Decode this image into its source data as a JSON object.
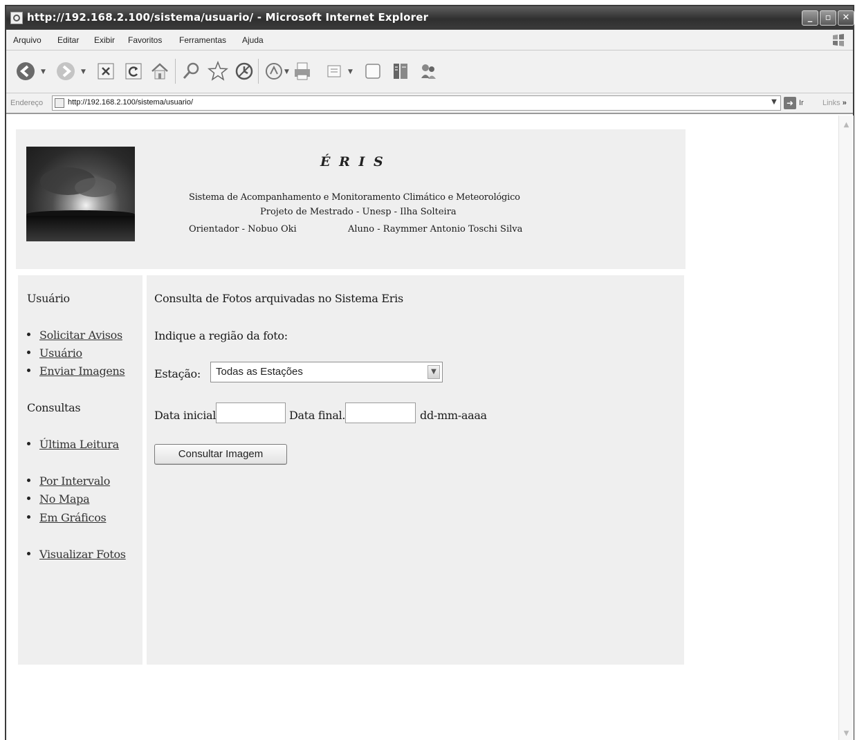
{
  "window": {
    "title": "http://192.168.2.100/sistema/usuario/ - Microsoft Internet Explorer",
    "min_glyph": "_",
    "max_glyph": "▫",
    "close_glyph": "✕"
  },
  "menu": [
    "Arquivo",
    "Editar",
    "Exibir",
    "Favoritos",
    "Ferramentas",
    "Ajuda"
  ],
  "toolbar": {
    "icons": [
      "back-icon",
      "forward-icon",
      "stop-icon",
      "refresh-icon",
      "home-icon",
      "search-icon",
      "favorites-icon",
      "history-icon",
      "mail-icon",
      "print-icon",
      "edit-icon",
      "discuss-icon",
      "messenger-icon",
      "research-icon"
    ]
  },
  "address": {
    "label": "Endereço",
    "url": "http://192.168.2.100/sistema/usuario/",
    "go_label": "Ir",
    "links_label": "Links",
    "chevron": "»"
  },
  "header": {
    "title": "É R I S",
    "line1": "Sistema de Acompanhamento e Monitoramento Climático e Meteorológico",
    "line2": "Projeto de Mestrado - Unesp - Ilha Solteira",
    "orientador": "Orientador - Nobuo Oki",
    "aluno": "Aluno - Raymmer Antonio Toschi Silva"
  },
  "sidebar": {
    "usuario_heading": "Usuário",
    "usuario_links": [
      "Solicitar Avisos",
      "Usuário",
      "Enviar Imagens"
    ],
    "consultas_heading": "Consultas",
    "consultas_links": [
      "Última Leitura",
      "Por Intervalo",
      "No Mapa",
      "Em Gráficos",
      "Visualizar Fotos"
    ]
  },
  "main": {
    "title": "Consulta de Fotos arquivadas no Sistema Eris",
    "prompt": "Indique a região da foto:",
    "estacao_label": "Estação:",
    "estacao_value": "Todas as Estações",
    "data_inicial_label": "Data inicial:",
    "data_inicial_value": "",
    "data_final_label": "Data final.:",
    "data_final_value": "",
    "date_format": "dd-mm-aaaa",
    "button": "Consultar Imagem"
  }
}
